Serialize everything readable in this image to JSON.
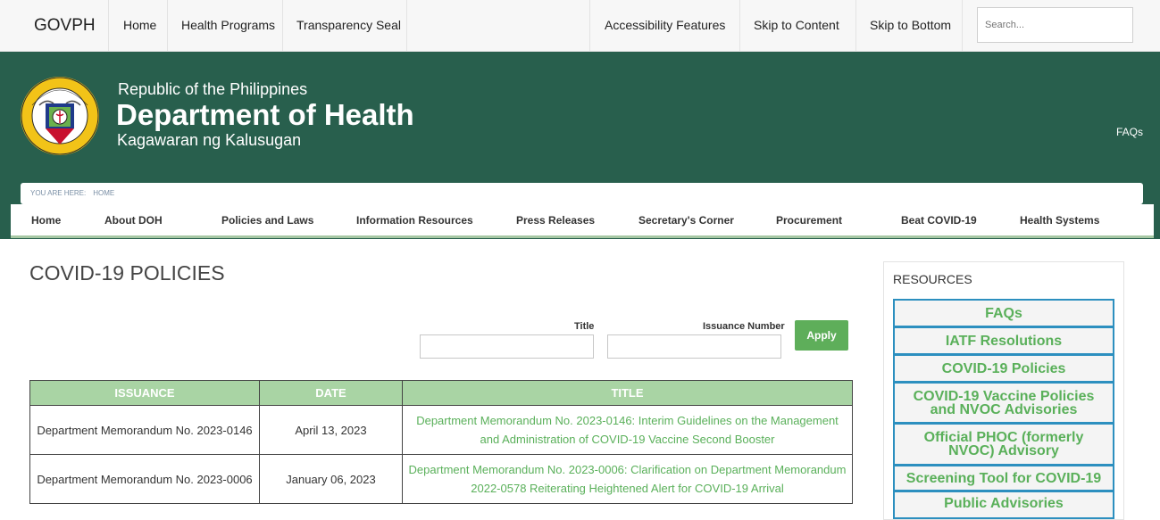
{
  "topbar": {
    "govph": "GOVPH",
    "links": [
      "Home",
      "Health Programs",
      "Transparency Seal"
    ],
    "right_links": [
      "Accessibility Features",
      "Skip to Content",
      "Skip to Bottom"
    ],
    "search_placeholder": "Search..."
  },
  "header": {
    "line1": "Republic of the Philippines",
    "line2": "Department of Health",
    "line3": "Kagawaran ng Kalusugan",
    "faqs": "FAQs"
  },
  "breadcrumb": {
    "label": "YOU ARE HERE:",
    "current": "HOME"
  },
  "nav": [
    "Home",
    "About DOH",
    "Policies and Laws",
    "Information Resources",
    "Press Releases",
    "Secretary's Corner",
    "Procurement",
    "Beat COVID-19",
    "Health Systems"
  ],
  "main": {
    "title": "COVID-19 POLICIES",
    "filter_title_label": "Title",
    "filter_number_label": "Issuance Number",
    "apply_label": "Apply",
    "table": {
      "headers": [
        "ISSUANCE",
        "DATE",
        "TITLE"
      ],
      "rows": [
        {
          "issuance": "Department Memorandum No. 2023-0146",
          "date": "April 13, 2023",
          "title": "Department Memorandum No. 2023-0146: Interim Guidelines on the Management and Administration of COVID-19 Vaccine Second Booster"
        },
        {
          "issuance": "Department Memorandum No. 2023-0006",
          "date": "January 06, 2023",
          "title": "Department Memorandum No. 2023-0006: Clarification on Department Memorandum 2022-0578 Reiterating Heightened Alert for COVID-19 Arrival"
        }
      ]
    }
  },
  "resources": {
    "title": "RESOURCES",
    "items": [
      "FAQs",
      "IATF Resolutions",
      "COVID-19 Policies",
      "COVID-19 Vaccine Policies and NVOC Advisories",
      "Official PHOC (formerly NVOC) Advisory",
      "Screening Tool for COVID-19",
      "Public Advisories"
    ]
  },
  "colors": {
    "header_green": "#285f4d",
    "link_green": "#5ab05a",
    "table_header": "#a9d4a4",
    "resource_border": "#2c8fbf"
  }
}
